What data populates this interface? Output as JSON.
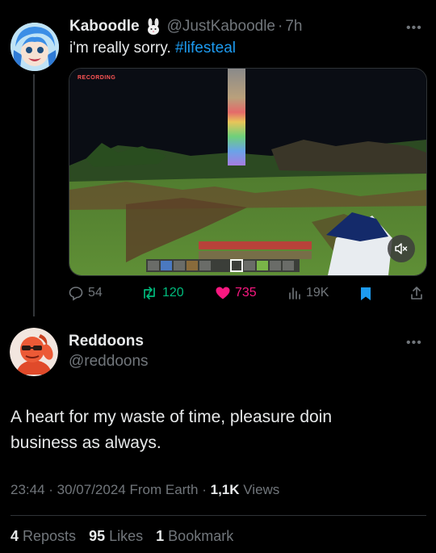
{
  "first_post": {
    "display_name": "Kaboodle",
    "handle": "@JustKaboodle",
    "dot": "·",
    "time": "7h",
    "text_plain": "i'm really sorry. ",
    "hashtag": "#lifesteal",
    "media": {
      "overlay_text": "RECORDING",
      "mute_icon": "speaker-mute-icon"
    },
    "actions": {
      "replies": "54",
      "reposts": "120",
      "likes": "735",
      "views": "19K"
    }
  },
  "second_post": {
    "display_name": "Reddoons",
    "handle": "@reddoons",
    "text": "A heart for my waste of time, pleasure doin business as always.",
    "meta": {
      "time": "23:44",
      "sep1": " · ",
      "date": "30/07/2024",
      "source": " From Earth",
      "sep2": " · ",
      "views_count": "1,1K",
      "views_label": " Views"
    },
    "stats": {
      "reposts_count": "4",
      "reposts_label": " Reposts",
      "likes_count": "95",
      "likes_label": " Likes",
      "bookmarks_count": "1",
      "bookmarks_label": " Bookmark"
    }
  },
  "colors": {
    "background": "#000000",
    "text": "#e7e9ea",
    "secondary": "#71767b",
    "link": "#1d9bf0",
    "like": "#f91880",
    "repost": "#00ba7c",
    "bookmark": "#1d9bf0"
  }
}
